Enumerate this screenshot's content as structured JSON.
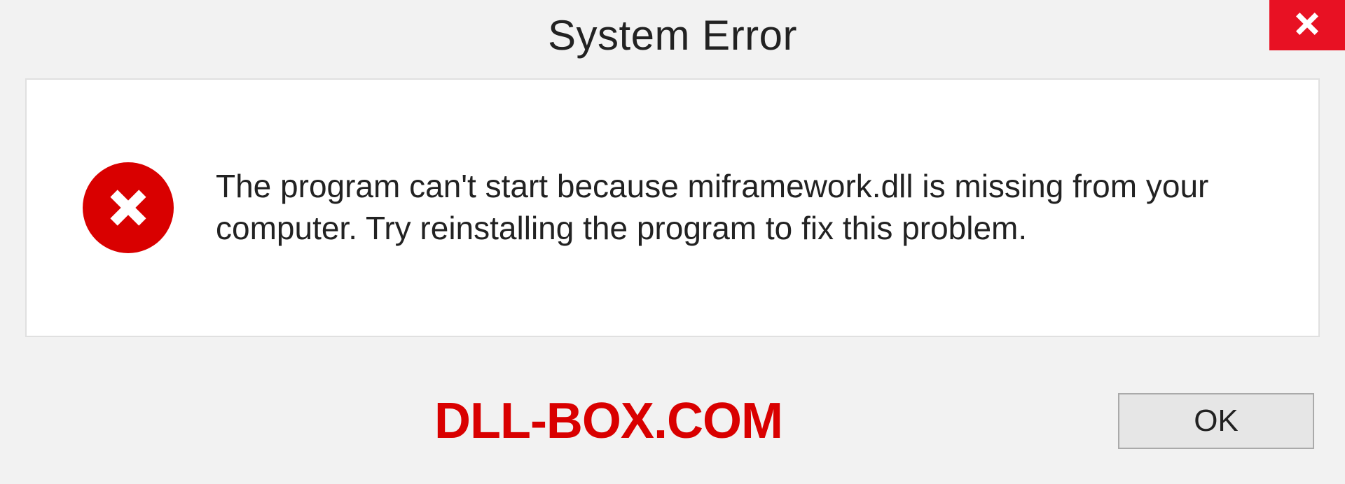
{
  "dialog": {
    "title": "System Error",
    "message": "The program can't start because miframework.dll is missing from your computer. Try reinstalling the program to fix this problem.",
    "ok_label": "OK"
  },
  "watermark": "DLL-BOX.COM"
}
